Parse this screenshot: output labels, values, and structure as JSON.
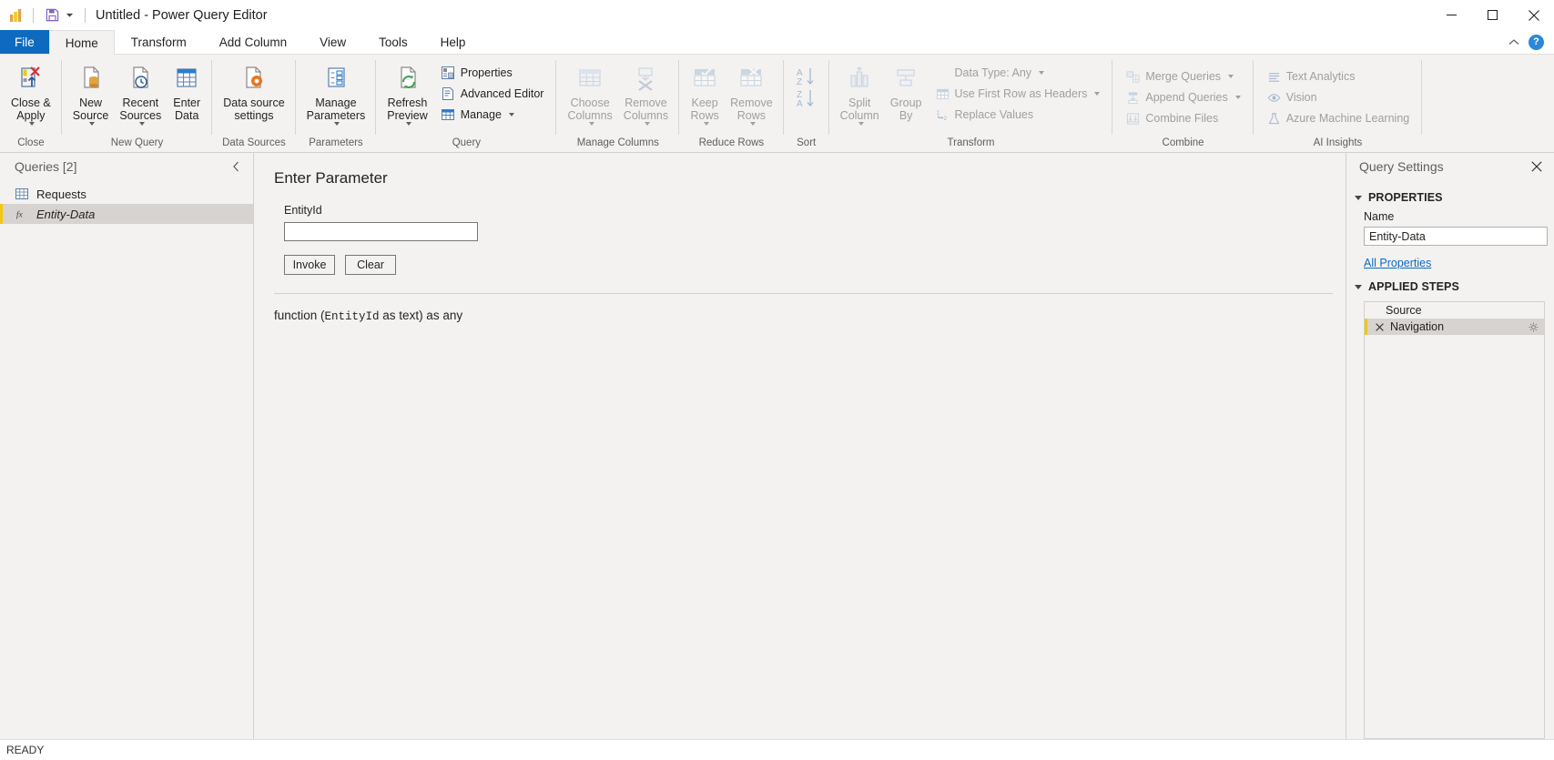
{
  "window": {
    "title": "Untitled - Power Query Editor",
    "logo_icon": "power-bi-logo-icon",
    "save_icon": "save-icon",
    "qat_caret_icon": "chevron-down-icon",
    "minimize_icon": "minimize-icon",
    "maximize_icon": "maximize-icon",
    "close_icon": "close-icon"
  },
  "ribbon": {
    "tabs": [
      {
        "label": "File",
        "kind": "file"
      },
      {
        "label": "Home",
        "kind": "active"
      },
      {
        "label": "Transform",
        "kind": "normal"
      },
      {
        "label": "Add Column",
        "kind": "normal"
      },
      {
        "label": "View",
        "kind": "normal"
      },
      {
        "label": "Tools",
        "kind": "normal"
      },
      {
        "label": "Help",
        "kind": "normal"
      }
    ],
    "collapse_icon": "chevron-up-icon",
    "help_label": "?",
    "groups": [
      {
        "label": "Close",
        "items": [
          {
            "label": "Close &\nApply",
            "icon": "close-apply-icon",
            "caret": true
          }
        ]
      },
      {
        "label": "New Query",
        "items": [
          {
            "label": "New\nSource",
            "icon": "new-source-icon",
            "caret": true
          },
          {
            "label": "Recent\nSources",
            "icon": "recent-sources-icon",
            "caret": true
          },
          {
            "label": "Enter\nData",
            "icon": "enter-data-icon",
            "caret": false
          }
        ]
      },
      {
        "label": "Data Sources",
        "items": [
          {
            "label": "Data source\nsettings",
            "icon": "data-source-settings-icon",
            "caret": false
          }
        ]
      },
      {
        "label": "Parameters",
        "items": [
          {
            "label": "Manage\nParameters",
            "icon": "manage-parameters-icon",
            "caret": true
          }
        ]
      },
      {
        "label": "Query",
        "items": [
          {
            "label": "Refresh\nPreview",
            "icon": "refresh-preview-icon",
            "caret": true
          }
        ],
        "small": [
          {
            "label": "Properties",
            "icon": "properties-icon",
            "caret": false
          },
          {
            "label": "Advanced Editor",
            "icon": "advanced-editor-icon",
            "caret": false
          },
          {
            "label": "Manage",
            "icon": "manage-icon",
            "caret": true
          }
        ]
      },
      {
        "label": "Manage Columns",
        "items": [
          {
            "label": "Choose\nColumns",
            "icon": "choose-columns-icon",
            "caret": true,
            "disabled": true
          },
          {
            "label": "Remove\nColumns",
            "icon": "remove-columns-icon",
            "caret": true,
            "disabled": true
          }
        ]
      },
      {
        "label": "Reduce Rows",
        "items": [
          {
            "label": "Keep\nRows",
            "icon": "keep-rows-icon",
            "caret": true,
            "disabled": true
          },
          {
            "label": "Remove\nRows",
            "icon": "remove-rows-icon",
            "caret": true,
            "disabled": true
          }
        ]
      },
      {
        "label": "Sort",
        "items": [
          {
            "label": "",
            "icon": "sort-ascending-descending-icon",
            "caret": false,
            "disabled": true
          }
        ]
      },
      {
        "label": "Transform",
        "items": [
          {
            "label": "Split\nColumn",
            "icon": "split-column-icon",
            "caret": true,
            "disabled": true
          },
          {
            "label": "Group\nBy",
            "icon": "group-by-icon",
            "caret": false,
            "disabled": true
          }
        ],
        "small": [
          {
            "label": "Data Type: Any",
            "icon": "data-type-icon",
            "caret": true,
            "disabled": true
          },
          {
            "label": "Use First Row as Headers",
            "icon": "use-first-row-as-headers-icon",
            "caret": true,
            "disabled": true
          },
          {
            "label": "Replace Values",
            "icon": "replace-values-icon",
            "caret": false,
            "disabled": true
          }
        ]
      },
      {
        "label": "Combine",
        "small": [
          {
            "label": "Merge Queries",
            "icon": "merge-queries-icon",
            "caret": true,
            "disabled": true
          },
          {
            "label": "Append Queries",
            "icon": "append-queries-icon",
            "caret": true,
            "disabled": true
          },
          {
            "label": "Combine Files",
            "icon": "combine-files-icon",
            "caret": false,
            "disabled": true
          }
        ]
      },
      {
        "label": "AI Insights",
        "small": [
          {
            "label": "Text Analytics",
            "icon": "text-analytics-icon",
            "caret": false,
            "disabled": true
          },
          {
            "label": "Vision",
            "icon": "vision-icon",
            "caret": false,
            "disabled": true
          },
          {
            "label": "Azure Machine Learning",
            "icon": "azure-machine-learning-icon",
            "caret": false,
            "disabled": true
          }
        ]
      }
    ]
  },
  "queries_pane": {
    "title": "Queries [2]",
    "collapse_icon": "chevron-left-icon",
    "items": [
      {
        "label": "Requests",
        "icon": "table-icon",
        "selected": false,
        "italic": false
      },
      {
        "label": "Entity-Data",
        "icon": "function-fx-icon",
        "selected": true,
        "italic": true
      }
    ]
  },
  "main": {
    "parameter_title": "Enter Parameter",
    "parameter_label": "EntityId",
    "parameter_value": "",
    "parameter_placeholder": "",
    "invoke_label": "Invoke",
    "clear_label": "Clear",
    "function_signature_prefix": "function (",
    "function_signature_param": "EntityId",
    "function_signature_suffix": " as text) as any"
  },
  "query_settings": {
    "title": "Query Settings",
    "close_icon": "close-icon",
    "properties_section": "PROPERTIES",
    "name_label": "Name",
    "name_value": "Entity-Data",
    "all_properties_label": "All Properties",
    "applied_steps_section": "APPLIED STEPS",
    "steps": [
      {
        "label": "Source",
        "selected": false,
        "has_delete": false,
        "has_gear": false
      },
      {
        "label": "Navigation",
        "selected": true,
        "has_delete": true,
        "has_gear": true
      }
    ]
  },
  "status": {
    "text": "READY"
  },
  "colors": {
    "accent_blue": "#0d6abf",
    "selection_yellow": "#f2c811",
    "ribbon_bg": "#f3f2f1",
    "link_blue": "#0d6abf",
    "disabled_gray": "#a19f9d"
  }
}
